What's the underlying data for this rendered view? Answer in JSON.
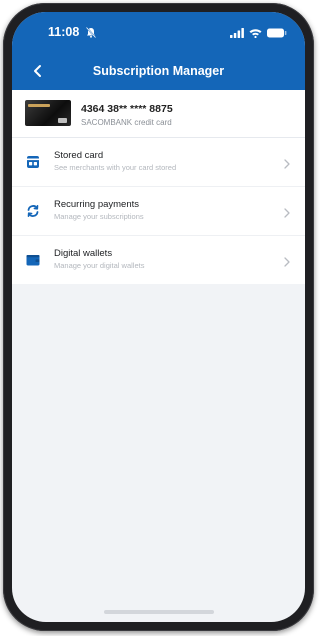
{
  "status_bar": {
    "time": "11:08"
  },
  "header": {
    "title": "Subscription Manager"
  },
  "card": {
    "number": "4364 38** **** 8875",
    "description": "SACOMBANK credit card"
  },
  "menu": {
    "items": [
      {
        "title": "Stored card",
        "subtitle": "See merchants with your card stored",
        "icon": "stored-card-icon"
      },
      {
        "title": "Recurring payments",
        "subtitle": "Manage your subscriptions",
        "icon": "recurring-icon"
      },
      {
        "title": "Digital wallets",
        "subtitle": "Manage your digital wallets",
        "icon": "wallet-icon"
      }
    ]
  },
  "colors": {
    "brand": "#1466b8",
    "background": "#f1f3f6"
  }
}
